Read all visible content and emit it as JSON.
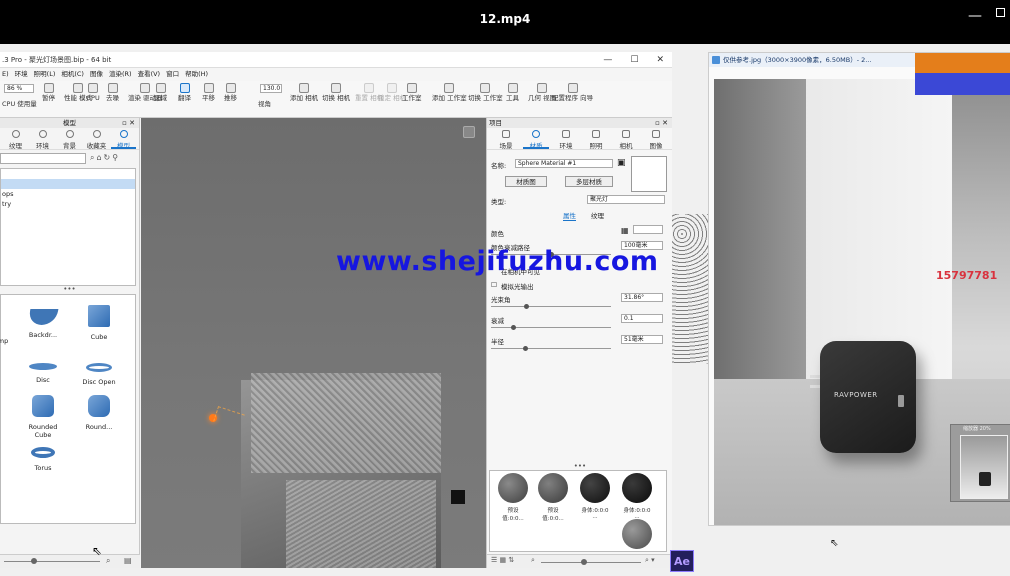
{
  "player": {
    "title": "12.mp4",
    "minimize": "—"
  },
  "ks": {
    "title": ".3 Pro - 聚光灯场景图.bip - 64 bit",
    "window_buttons": [
      "—",
      "☐",
      "✕"
    ],
    "menu": [
      "E)",
      "环境",
      "照明(L)",
      "相机(C)",
      "图像",
      "渲染(R)",
      "查看(V)",
      "窗口",
      "帮助(H)"
    ],
    "toolbar": {
      "zoom_value": "86 %",
      "fov_value": "130.0",
      "items": [
        {
          "label": "CPU 使用量",
          "id": "cpu"
        },
        {
          "label": "暂停",
          "id": "pause"
        },
        {
          "label": "性能\n模式",
          "id": "perf"
        },
        {
          "label": "GPU",
          "id": "gpu"
        },
        {
          "label": "去噪",
          "id": "denoise"
        },
        {
          "label": "渲染\n驱动器",
          "id": "render"
        },
        {
          "label": "区域",
          "id": "region"
        },
        {
          "label": "翻译",
          "id": "translate"
        },
        {
          "label": "平移",
          "id": "pan"
        },
        {
          "label": "推移",
          "id": "dolly"
        },
        {
          "label": "视角",
          "id": "view"
        },
        {
          "label": "添加\n相机",
          "id": "addcam"
        },
        {
          "label": "切换\n相机",
          "id": "switchcam"
        },
        {
          "label": "重置\n相机",
          "id": "resetcam"
        },
        {
          "label": "锁定\n相机",
          "id": "lockcam"
        },
        {
          "label": "工作室",
          "id": "studio"
        },
        {
          "label": "添加\n工作室",
          "id": "addstudio"
        },
        {
          "label": "切换\n工作室",
          "id": "switchstudio"
        },
        {
          "label": "工具",
          "id": "tools"
        },
        {
          "label": "几何\n视图",
          "id": "geoview"
        },
        {
          "label": "配置程序\n向导",
          "id": "configwizard"
        }
      ]
    },
    "library": {
      "header": "模型",
      "tabs": [
        "纹理",
        "环境",
        "背景",
        "收藏夹",
        "模型"
      ],
      "tree": [
        "",
        "ops",
        "try"
      ],
      "models": [
        "amp",
        "Backdr...",
        "Cube",
        "Disc",
        "Disc Open",
        "Rounded Cube",
        "Round...",
        "Torus"
      ]
    },
    "properties": {
      "header": "项目",
      "tabs": [
        "场景",
        "材质",
        "环境",
        "照明",
        "相机",
        "图像"
      ],
      "name_label": "名称:",
      "name_value": "Sphere Material #1",
      "material_graph_btn": "材质图",
      "multi_material_btn": "多层材质",
      "type_label": "类型:",
      "type_value": "聚光灯",
      "subtab_props": "属性",
      "subtab_texture": "纹理",
      "color_label": "颜色",
      "spread_label": "颜色衰减路径",
      "spread_value": "100毫米",
      "camera_label": "在相机中可见",
      "light_fix_label": "模拟光输出",
      "beam_label": "光束角",
      "beam_value": "31.86°",
      "falloff_label": "衰减",
      "falloff_value": "0.1",
      "radius_label": "半径",
      "radius_value": "51毫米",
      "swatches": [
        "预设值:0:0...",
        "预设值:0:0...",
        "身体:0:0:0 ...",
        "身体:0:0:0 ..."
      ]
    }
  },
  "viewer": {
    "title": "仅供参考.jpg（3000×3900像素，6.50MB）- 2...",
    "product_brand": "RAVPOWER",
    "phone_text": "15797781",
    "navigator_label": "缩放器 20%"
  },
  "watermark": "www.shejifuzhu.com",
  "taskbar": {
    "ae_label": "Ae"
  },
  "colors": {
    "accent": "#1a74c9",
    "watermark": "#1616e0",
    "orange": "#e47e1b",
    "purple_bar": "#3b48d6"
  }
}
